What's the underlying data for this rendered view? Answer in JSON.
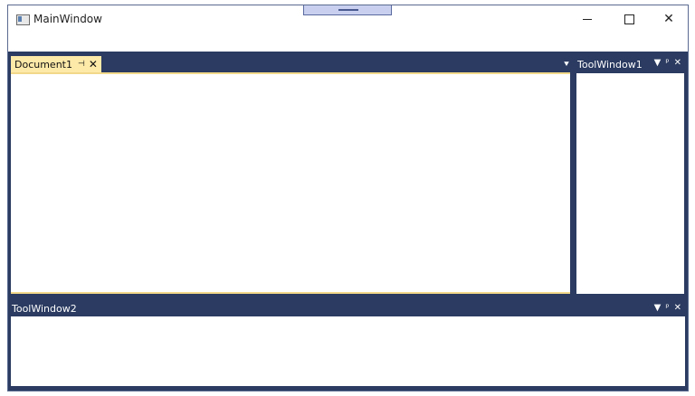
{
  "window": {
    "title": "MainWindow",
    "icons": {
      "app": "app-icon",
      "minimize": "minimize-icon",
      "maximize": "maximize-icon",
      "close": "close-icon"
    },
    "glyphs": {
      "close": "✕"
    }
  },
  "document_pane": {
    "tabs": [
      {
        "label": "Document1",
        "active": true
      }
    ],
    "glyphs": {
      "pin": "⊣",
      "close": "✕",
      "menu": "⯆"
    },
    "active_tab_color": "#fde9a8"
  },
  "tool_windows": {
    "right": {
      "title": "ToolWindow1",
      "glyphs": {
        "menu": "▼",
        "pin": "ᵖ",
        "close": "✕"
      }
    },
    "bottom": {
      "title": "ToolWindow2",
      "glyphs": {
        "menu": "▼",
        "pin": "ᵖ",
        "close": "✕"
      }
    }
  },
  "colors": {
    "dock_background": "#2b3b61",
    "grip": "#c9d0ef"
  }
}
